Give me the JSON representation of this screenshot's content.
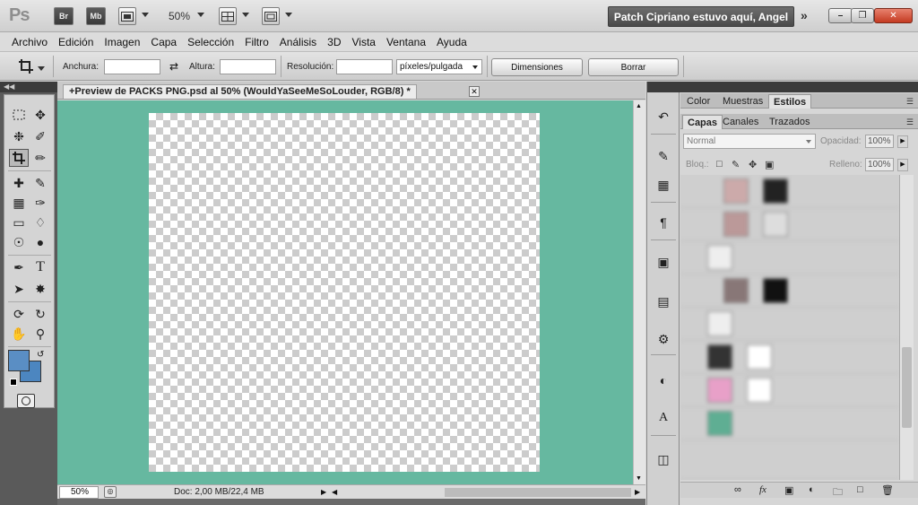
{
  "appbar": {
    "logo": "Ps",
    "bridge": "Br",
    "minibridge": "Mb",
    "zoom": "50%",
    "workspace": "Patch Cipriano estuvo aquí, Angel",
    "more": "»"
  },
  "menu": [
    "Archivo",
    "Edición",
    "Imagen",
    "Capa",
    "Selección",
    "Filtro",
    "Análisis",
    "3D",
    "Vista",
    "Ventana",
    "Ayuda"
  ],
  "options": {
    "width_label": "Anchura:",
    "height_label": "Altura:",
    "resolution_label": "Resolución:",
    "width_value": "",
    "height_value": "",
    "resolution_value": "",
    "unit": "píxeles/pulgada",
    "front_image_button": "Dimensiones",
    "clear_button": "Borrar"
  },
  "document": {
    "tab_title": "+Preview de PACKS PNG.psd al 50% (WouldYaSeeMeSoLouder, RGB/8) *",
    "zoom": "50%",
    "doc_info": "Doc: 2,00 MB/22,4 MB",
    "canvas_bg": "#66b8a0"
  },
  "colors": {
    "foreground": "#5a8ec4",
    "background": "#4c86c0"
  },
  "panels": {
    "top_tabs": [
      "Color",
      "Muestras",
      "Estilos"
    ],
    "layer_tabs": [
      "Capas",
      "Canales",
      "Trazados"
    ],
    "blend_mode": "Normal",
    "opacity_label": "Opacidad:",
    "opacity": "100%",
    "lock_label": "Bloq.:",
    "fill_label": "Relleno:",
    "fill": "100%"
  }
}
